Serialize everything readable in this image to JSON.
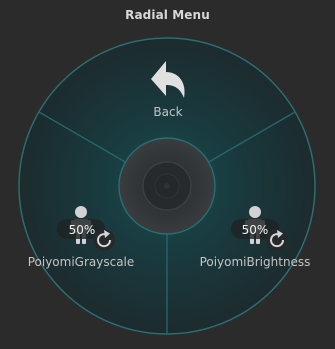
{
  "window": {
    "title": "Radial Menu"
  },
  "menu": {
    "back": {
      "label": "Back",
      "icon": "back-arrow-icon"
    },
    "items": [
      {
        "label": "PoiyomiGrayscale",
        "value_text": "50%",
        "value": 0.5,
        "icon": "avatar-figure-icon",
        "reset_icon": "reset-icon"
      },
      {
        "label": "PoiyomiBrightness",
        "value_text": "50%",
        "value": 0.5,
        "icon": "avatar-figure-icon",
        "reset_icon": "reset-icon"
      }
    ]
  },
  "colors": {
    "background": "#2b2b2b",
    "ring": "#1f5f63",
    "accent": "#2a7b7e",
    "text": "#c4c4c4",
    "title": "#d8d8d8"
  }
}
